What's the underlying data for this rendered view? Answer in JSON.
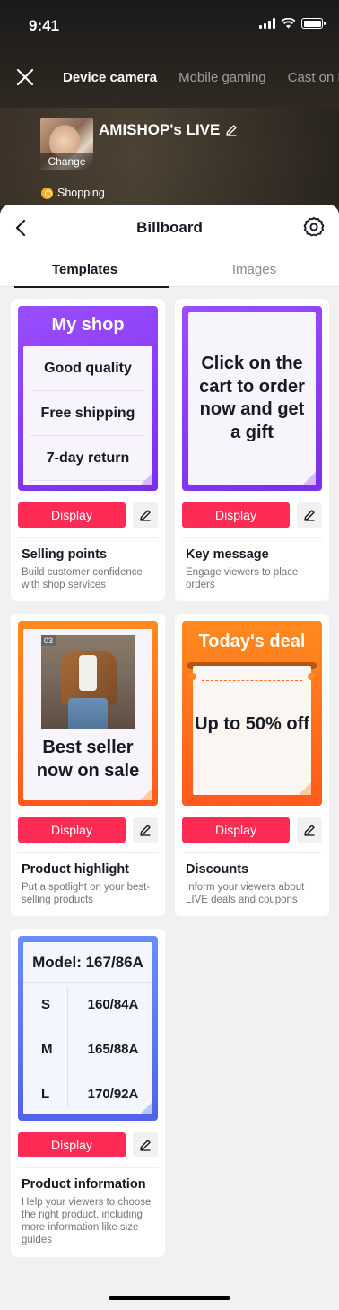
{
  "status_bar": {
    "time": "9:41"
  },
  "top": {
    "source_tabs": [
      "Device camera",
      "Mobile gaming",
      "Cast on P"
    ],
    "live_title": "AMISHOP's LIVE",
    "cover_change_label": "Change",
    "shopping_label": "Shopping"
  },
  "sheet": {
    "title": "Billboard",
    "tabs": [
      "Templates",
      "Images"
    ]
  },
  "templates": [
    {
      "name": "Selling points",
      "description": "Build customer confidence with shop services",
      "display_label": "Display",
      "preview": {
        "title": "My shop",
        "items": [
          "Good quality",
          "Free shipping",
          "7-day return"
        ]
      }
    },
    {
      "name": "Key message",
      "description": "Engage viewers to place orders",
      "display_label": "Display",
      "preview": {
        "text": "Click on the cart to order now and get a gift"
      }
    },
    {
      "name": "Product highlight",
      "description": "Put a spotlight on your best-selling products",
      "display_label": "Display",
      "preview": {
        "badge": "03",
        "text": "Best seller now on sale"
      }
    },
    {
      "name": "Discounts",
      "description": "Inform your viewers about LIVE deals and coupons",
      "display_label": "Display",
      "preview": {
        "title": "Today's deal",
        "text": "Up to 50% off"
      }
    },
    {
      "name": "Product information",
      "description": "Help your viewers to choose the right product, including more information like size guides",
      "display_label": "Display",
      "preview": {
        "title": "Model: 167/86A",
        "rows": [
          {
            "size": "S",
            "value": "160/84A"
          },
          {
            "size": "M",
            "value": "165/88A"
          },
          {
            "size": "L",
            "value": "170/92A"
          }
        ]
      }
    }
  ],
  "colors": {
    "accent": "#fe2c55",
    "purple": "#8a3cf5",
    "orange": "#ff6a1a",
    "blue": "#5d78f0"
  }
}
